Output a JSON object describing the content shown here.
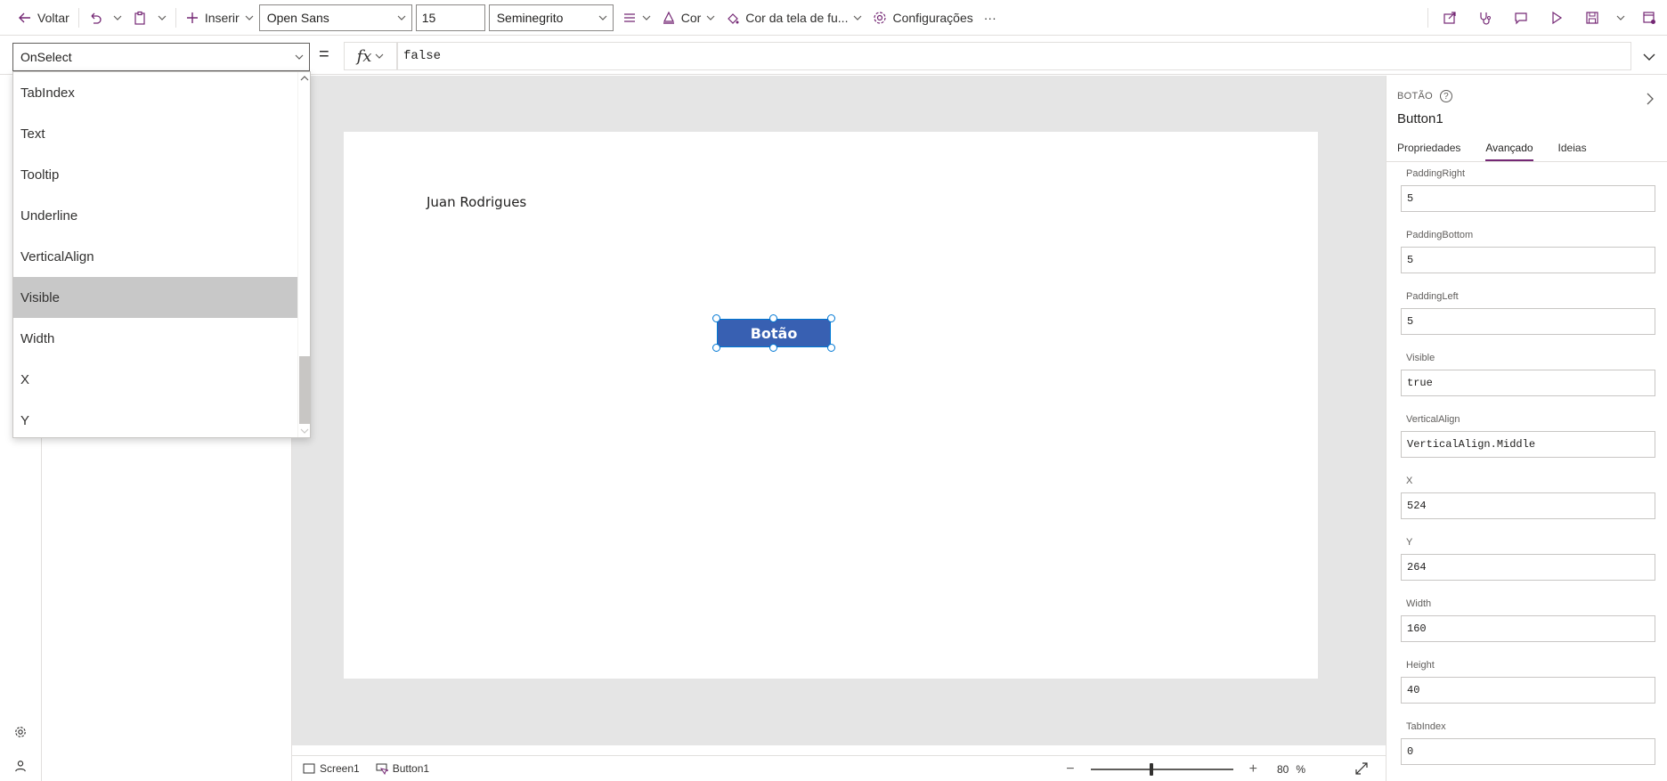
{
  "toolbar": {
    "back_label": "Voltar",
    "insert_label": "Inserir",
    "font_family": "Open Sans",
    "font_size": "15",
    "font_weight": "Seminegrito",
    "color_label": "Cor",
    "screen_color_label": "Cor da tela de fu...",
    "settings_label": "Configurações",
    "more_label": "···"
  },
  "formula_bar": {
    "property": "OnSelect",
    "equals": "=",
    "fx_label": "fx",
    "formula": "false"
  },
  "property_dropdown": {
    "items": [
      "TabIndex",
      "Text",
      "Tooltip",
      "Underline",
      "VerticalAlign",
      "Visible",
      "Width",
      "X",
      "Y"
    ],
    "selected": "Visible"
  },
  "canvas": {
    "label_text": "Juan Rodrigues",
    "button_text": "Botão"
  },
  "statusbar": {
    "screen_crumb": "Screen1",
    "control_crumb": "Button1",
    "zoom_value": "80",
    "zoom_unit": "%",
    "zoom_level": 0.8
  },
  "props_pane": {
    "type_label": "BOTÃO",
    "control_name": "Button1",
    "tabs": [
      "Propriedades",
      "Avançado",
      "Ideias"
    ],
    "active_tab": "Avançado",
    "properties": [
      {
        "label": "PaddingRight",
        "value": "5"
      },
      {
        "label": "PaddingBottom",
        "value": "5"
      },
      {
        "label": "PaddingLeft",
        "value": "5"
      },
      {
        "label": "Visible",
        "value": "true"
      },
      {
        "label": "VerticalAlign",
        "value": "VerticalAlign.Middle"
      },
      {
        "label": "X",
        "value": "524"
      },
      {
        "label": "Y",
        "value": "264"
      },
      {
        "label": "Width",
        "value": "160"
      },
      {
        "label": "Height",
        "value": "40"
      },
      {
        "label": "TabIndex",
        "value": "0"
      }
    ]
  },
  "colors": {
    "accent": "#742774",
    "button_fill": "#3860b2",
    "selection": "#0078d4",
    "canvas_bg": "#e5e5e5"
  }
}
